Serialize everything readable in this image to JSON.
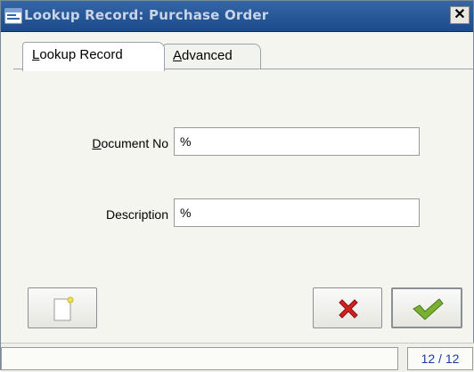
{
  "window": {
    "title": "Lookup Record: Purchase Order",
    "close_glyph": "✕"
  },
  "tabs": [
    {
      "prefix": "",
      "mnemonic": "L",
      "rest": "ookup Record",
      "active": true
    },
    {
      "prefix": "",
      "mnemonic": "A",
      "rest": "dvanced",
      "active": false
    }
  ],
  "fields": {
    "document_no": {
      "mnemonic": "D",
      "rest": "ocument No",
      "value": "%"
    },
    "description": {
      "value": "%",
      "label": "Description"
    }
  },
  "buttons": {
    "new_icon": "new-document-icon",
    "cancel_icon": "red-x-icon",
    "ok_icon": "green-check-icon"
  },
  "status": {
    "left": "",
    "record_count": "12 / 12"
  },
  "colors": {
    "title_bg": "#1c4a8a",
    "cancel_red": "#d42020",
    "ok_green": "#6aa02a",
    "count_blue": "#1a3aa0"
  }
}
